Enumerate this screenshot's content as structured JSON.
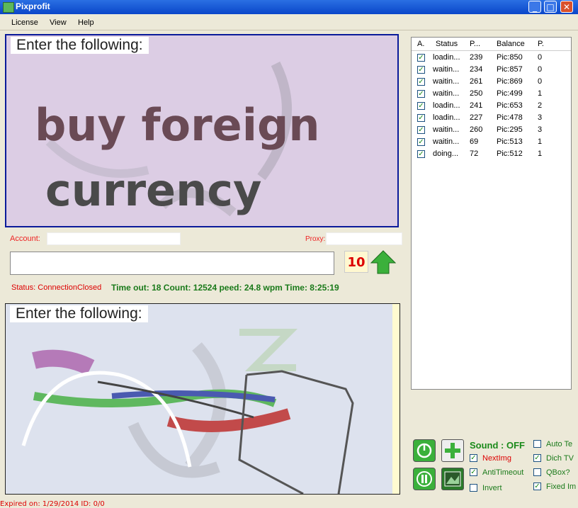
{
  "window": {
    "title": "Pixprofit"
  },
  "menu": {
    "license": "License",
    "view": "View",
    "help": "Help"
  },
  "captcha_top": {
    "prompt": "Enter the following:",
    "text_line1": "buy foreign",
    "text_line2": "currency"
  },
  "captcha_bottom": {
    "prompt": "Enter the following:"
  },
  "account": {
    "label": "Account:",
    "proxy_label": "Proxy:"
  },
  "answer": {
    "counter": "10"
  },
  "status": {
    "text": "Status: ConnectionClosed",
    "stats": "Time out: 18 Count: 12524 peed: 24.8 wpm Time: 8:25:19"
  },
  "table": {
    "headers": [
      "A.",
      "Status",
      "P...",
      "Balance",
      "P."
    ],
    "rows": [
      [
        "loadin...",
        "239",
        "Pic:850",
        "0"
      ],
      [
        "waitin...",
        "234",
        "Pic:857",
        "0"
      ],
      [
        "waitin...",
        "261",
        "Pic:869",
        "0"
      ],
      [
        "waitin...",
        "250",
        "Pic:499",
        "1"
      ],
      [
        "loadin...",
        "241",
        "Pic:653",
        "2"
      ],
      [
        "loadin...",
        "227",
        "Pic:478",
        "3"
      ],
      [
        "waitin...",
        "260",
        "Pic:295",
        "3"
      ],
      [
        "waitin...",
        "69",
        "Pic:513",
        "1"
      ],
      [
        "doing...",
        "72",
        "Pic:512",
        "1"
      ]
    ]
  },
  "controls": {
    "sound": "Sound : OFF",
    "nextimg": "NextImg",
    "antitimeout": "AntiTimeout",
    "invert": "Invert",
    "auto": "Auto Te",
    "dich": "Dich TV",
    "qbox": "QBox?",
    "fixed": "Fixed Im"
  },
  "footer": {
    "text": "Expired on: 1/29/2014  ID: 0/0"
  }
}
